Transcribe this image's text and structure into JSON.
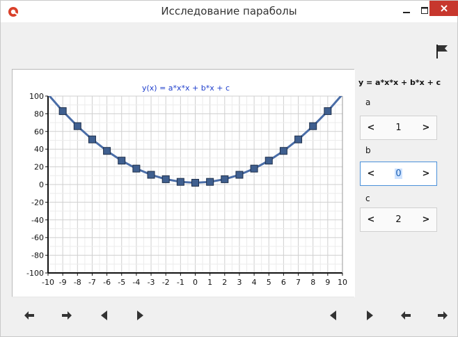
{
  "window": {
    "title": "Исследование параболы",
    "icons": {
      "app": "app-logo-icon",
      "minimize": "minimize-icon",
      "maximize": "maximize-icon",
      "close": "close-icon",
      "flag": "flag-icon"
    },
    "colors": {
      "close_button": "#c7372d",
      "chart_title": "#1f3fcc",
      "series_line": "#4a6da7",
      "marker_fill": "#3f5f8f"
    }
  },
  "side_panel": {
    "formula": "y = a*x*x + b*x + c",
    "params": [
      {
        "label": "a",
        "value": "1",
        "dec": "<",
        "inc": ">"
      },
      {
        "label": "b",
        "value": "0",
        "dec": "<",
        "inc": ">"
      },
      {
        "label": "c",
        "value": "2",
        "dec": "<",
        "inc": ">"
      }
    ]
  },
  "nav_buttons": [
    {
      "icon": "arrow-left-icon"
    },
    {
      "icon": "arrow-right-icon"
    },
    {
      "icon": "triangle-left-icon"
    },
    {
      "icon": "triangle-right-icon"
    },
    {
      "icon": "triangle-left-icon"
    },
    {
      "icon": "triangle-right-icon"
    },
    {
      "icon": "arrow-left-icon"
    },
    {
      "icon": "arrow-right-icon"
    }
  ],
  "chart_data": {
    "type": "line",
    "title": "y(x) = a*x*x + b*x + c",
    "xlabel": "",
    "ylabel": "",
    "xlim": [
      -10,
      10
    ],
    "ylim": [
      -100,
      100
    ],
    "grid": true,
    "x_ticks": [
      -10,
      -9,
      -8,
      -7,
      -6,
      -5,
      -4,
      -3,
      -2,
      -1,
      0,
      1,
      2,
      3,
      4,
      5,
      6,
      7,
      8,
      9,
      10
    ],
    "y_ticks": [
      -100,
      -80,
      -60,
      -40,
      -20,
      0,
      20,
      40,
      60,
      80,
      100
    ],
    "series": [
      {
        "x": [
          -10,
          -9,
          -8,
          -7,
          -6,
          -5,
          -4,
          -3,
          -2,
          -1,
          0,
          1,
          2,
          3,
          4,
          5,
          6,
          7,
          8,
          9,
          10
        ],
        "y": [
          102,
          83,
          66,
          51,
          38,
          27,
          18,
          11,
          6,
          3,
          2,
          3,
          6,
          11,
          18,
          27,
          38,
          51,
          66,
          83,
          102
        ]
      }
    ]
  }
}
